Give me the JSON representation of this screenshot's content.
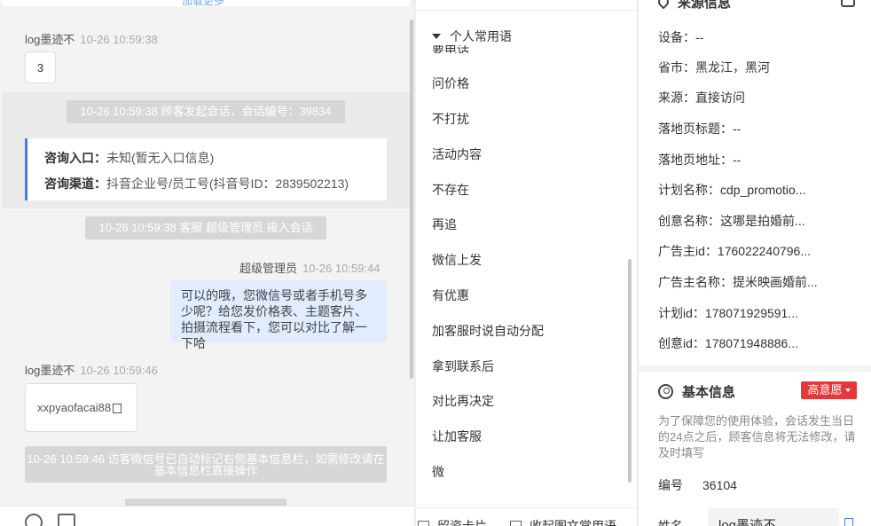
{
  "chat": {
    "top_link": "加载更多",
    "msg1": {
      "sender": "log墨迹不",
      "time": "10-26 10:59:38",
      "content": "3"
    },
    "sys1": "10-26 10:59:38 顾客发起会话，会话编号：39834",
    "consult": {
      "entry_label": "咨询入口：",
      "entry_value": "未知(暂无入口信息)",
      "channel_label": "咨询渠道：",
      "channel_value": "抖音企业号/员工号(抖音号ID：2839502213)"
    },
    "sys2": "10-26 10:59:38 客服 超级管理员 接入会话",
    "msg2": {
      "sender": "超级管理员",
      "time": "10-26 10:59:44",
      "content": "可以的哦，您微信号或者手机号多少呢？给您发价格表、主题客片、拍摄流程看下，您可以对比了解一下哈"
    },
    "msg3": {
      "sender": "log墨迹不",
      "time": "10-26 10:59:46",
      "content": "xxpyaofacai88"
    },
    "sys3": "10-26 10:59:46 访客微信号已自动标记右侧基本信息栏，如需修改请在基本信息栏直接操作",
    "toolbar": {
      "emoji": "emoji-icon",
      "image": "image-icon"
    }
  },
  "phrases": {
    "header": "个人常用语",
    "clipped_first": "要电话",
    "items": [
      "问价格",
      "不打扰",
      "活动内容",
      "不存在",
      "再追",
      "微信上发",
      "有优惠",
      "加客服时说自动分配",
      "拿到联系后",
      "对比再决定",
      "让加客服",
      "微"
    ],
    "bottom": {
      "left": "留资卡片",
      "right": "收起图文常用语"
    }
  },
  "source": {
    "title": "来源信息",
    "rows": [
      {
        "label": "设备：",
        "value": "--"
      },
      {
        "label": "省市：",
        "value": "黑龙江，黑河"
      },
      {
        "label": "来源：",
        "value": "直接访问"
      },
      {
        "label": "落地页标题：",
        "value": "--"
      },
      {
        "label": "落地页地址：",
        "value": "--"
      },
      {
        "label": "计划名称：",
        "value": "cdp_promotio..."
      },
      {
        "label": "创意名称：",
        "value": "这哪是拍婚前..."
      },
      {
        "label": "广告主id：",
        "value": "176022240796..."
      },
      {
        "label": "广告主名称：",
        "value": "提米映画婚前..."
      },
      {
        "label": "计划id：",
        "value": "178071929591..."
      },
      {
        "label": "创意id：",
        "value": "178071948886..."
      }
    ]
  },
  "basic": {
    "title": "基本信息",
    "intent_badge": "高意愿",
    "notice": "为了保障您的使用体验，会话发生当日的24点之后，顾客信息将无法修改，请及时填写",
    "number_label": "编号",
    "number_value": "36104",
    "name_label": "姓名",
    "name_value": "log墨迹不"
  },
  "colors": {
    "accent": "#3d7eff",
    "badge": "#e5383b",
    "my_bubble": "#e1ecff",
    "system_msg": "#d6d6d6"
  }
}
